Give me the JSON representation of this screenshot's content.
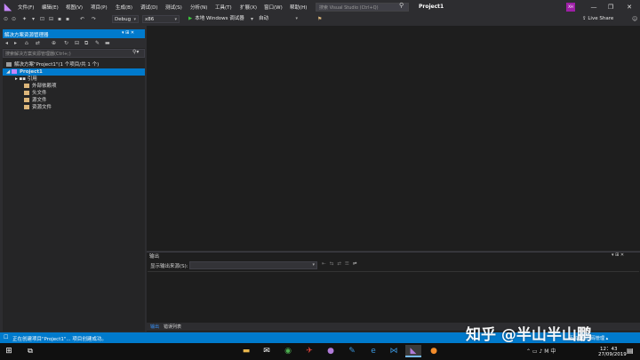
{
  "menubar": {
    "items": [
      "文件(F)",
      "编辑(E)",
      "视图(V)",
      "项目(P)",
      "生成(B)",
      "调试(D)",
      "测试(S)",
      "分析(N)",
      "工具(T)",
      "扩展(X)",
      "窗口(W)",
      "帮助(H)"
    ],
    "search_placeholder": "搜索 Visual Studio (Ctrl+Q)",
    "project_title": "Project1",
    "avatar_initials": "XH",
    "window_buttons": [
      "—",
      "❐",
      "✕"
    ]
  },
  "toolbar": {
    "config": "Debug",
    "platform": "x86",
    "run_label": "本地 Windows 调试器",
    "run_mode": "自动",
    "live_share": "Live Share"
  },
  "solution_explorer": {
    "title": "解决方案资源管理器",
    "header_buttons": "▾ ⊞ ✕",
    "search_placeholder": "搜索解决方案资源管理器(Ctrl+;)",
    "solution_label": "解决方案\"Project1\"(1 个项目/共 1 个)",
    "project_label": "Project1",
    "nodes": [
      "引用",
      "外部依赖项",
      "头文件",
      "源文件",
      "资源文件"
    ]
  },
  "output": {
    "title": "输出",
    "header_buttons": "▾ ⊞ ✕",
    "source_label": "显示输出来源(S):",
    "tabs": [
      "输出",
      "错误列表"
    ]
  },
  "statusbar": {
    "message": "正在创建项目\"Project1\"... 项目创建成功。",
    "right_text": "添加到源代码管理 ▴"
  },
  "watermark": "知乎 @半山半山鹏",
  "taskbar": {
    "time": "12：43",
    "date": "27/09/2019",
    "tray": "⌃  ▭  ♪  M  中"
  },
  "colors": {
    "accent": "#007acc",
    "background": "#2d2d30",
    "editor": "#1e1e1e"
  }
}
